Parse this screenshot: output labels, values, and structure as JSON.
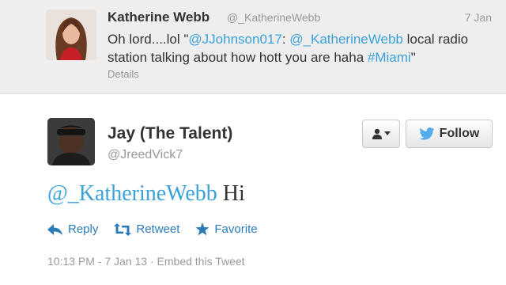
{
  "reply_tweet": {
    "name": "Katherine Webb",
    "handle": "@_KatherineWebb",
    "date": "7 Jan",
    "text_parts": [
      "Oh lord....lol \"",
      "@JJohnson017",
      ": ",
      "@_KatherineWebb",
      " local radio station talking about how hott you are haha ",
      "#Miami",
      "\""
    ],
    "details_label": "Details"
  },
  "main_tweet": {
    "name": "Jay (The Talent)",
    "handle": "@JreedVick7",
    "follow_label": "Follow",
    "mention": "@_KatherineWebb",
    "body": " Hi",
    "actions": {
      "reply": "Reply",
      "retweet": "Retweet",
      "favorite": "Favorite"
    },
    "timestamp": "10:13 PM - 7 Jan 13",
    "separator": " · ",
    "embed_label": "Embed this Tweet"
  },
  "colors": {
    "link": "#3aa2d9",
    "action": "#2b7bb9",
    "twitter_bird": "#55acee"
  }
}
